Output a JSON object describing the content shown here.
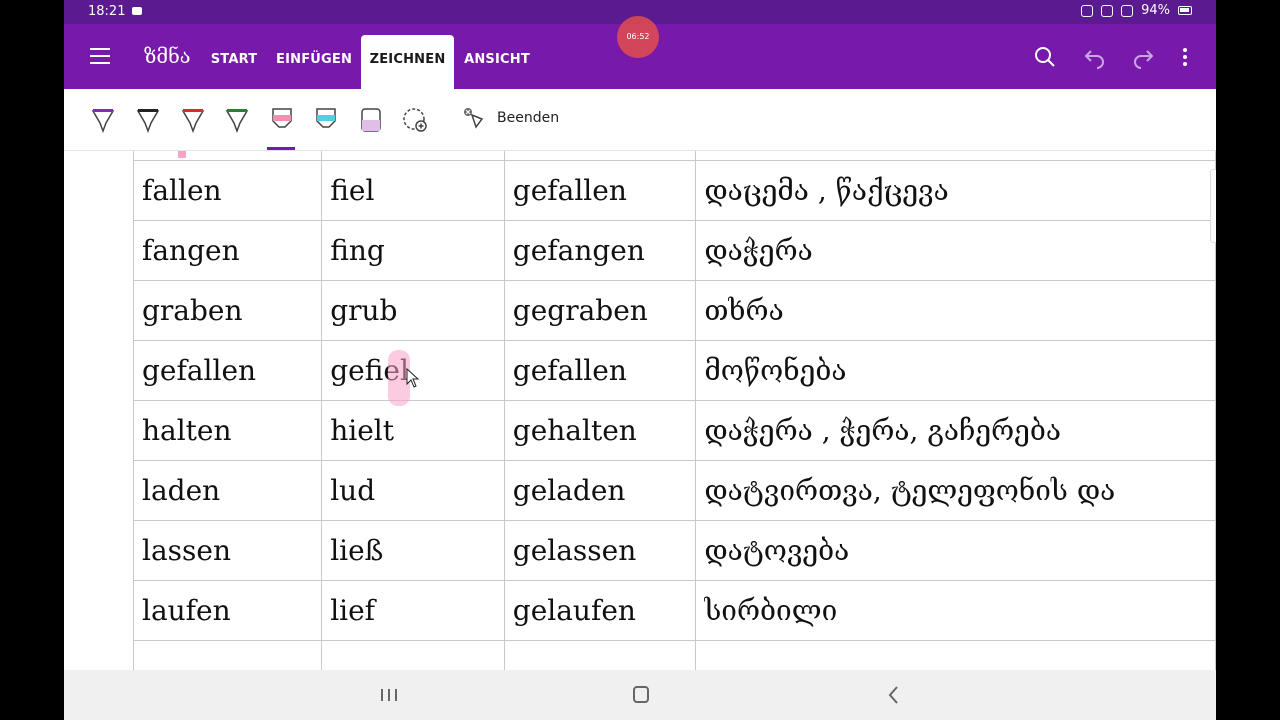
{
  "status": {
    "time": "18:21",
    "battery": "94%"
  },
  "appbar": {
    "notebook": "ზმნა",
    "tabs": [
      {
        "label": "START",
        "active": false
      },
      {
        "label": "EINFÜGEN",
        "active": false
      },
      {
        "label": "ZEICHNEN",
        "active": true
      },
      {
        "label": "ANSICHT",
        "active": false
      }
    ],
    "recording_timer": "06:52",
    "accent_color": "#7719aa"
  },
  "ribbon": {
    "pens": [
      {
        "name": "pen-purple",
        "color": "#7b2cbf"
      },
      {
        "name": "pen-black",
        "color": "#222222"
      },
      {
        "name": "pen-red",
        "color": "#d32f2f"
      },
      {
        "name": "pen-green",
        "color": "#2e7d32"
      },
      {
        "name": "highlighter-pink",
        "color": "#f48fb1"
      },
      {
        "name": "highlighter-cyan",
        "color": "#4dd0e1"
      },
      {
        "name": "highlighter-lilac",
        "color": "#e1bee7"
      }
    ],
    "finish_label": "Beenden"
  },
  "table": {
    "rows": [
      [
        "",
        "",
        "",
        ""
      ],
      [
        "fallen",
        "fiel",
        "gefallen",
        "დაცემა , წაქცევა"
      ],
      [
        "fangen",
        "fing",
        "gefangen",
        "დაჭერა"
      ],
      [
        "graben",
        "grub",
        "gegraben",
        "თხრა"
      ],
      [
        "gefallen",
        "gefiel",
        "gefallen",
        "მოწონება"
      ],
      [
        "halten",
        "hielt",
        "gehalten",
        "დაჭერა , ჭერა, გაჩერება"
      ],
      [
        "laden",
        "lud",
        "geladen",
        "დატვირთვა, ტელეფონის და"
      ],
      [
        "lassen",
        "ließ",
        "gelassen",
        "დატოვება"
      ],
      [
        "laufen",
        "lief",
        "gelaufen",
        "სირბილი"
      ],
      [
        "",
        "",
        "",
        ""
      ]
    ]
  }
}
